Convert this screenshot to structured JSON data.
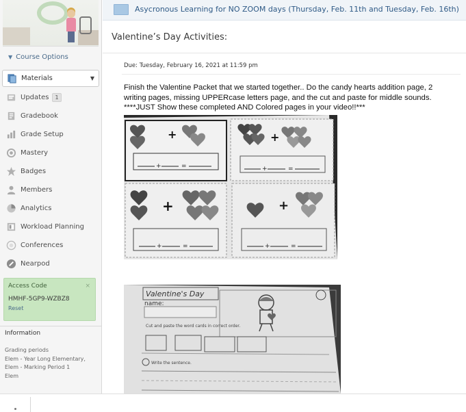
{
  "sidebar": {
    "course_options_label": "Course Options",
    "items": [
      {
        "label": "Materials",
        "icon": "materials-icon",
        "active": true
      },
      {
        "label": "Updates",
        "icon": "updates-icon",
        "count": "1"
      },
      {
        "label": "Gradebook",
        "icon": "gradebook-icon"
      },
      {
        "label": "Grade Setup",
        "icon": "grade-setup-icon"
      },
      {
        "label": "Mastery",
        "icon": "mastery-icon"
      },
      {
        "label": "Badges",
        "icon": "badge-icon"
      },
      {
        "label": "Members",
        "icon": "members-icon"
      },
      {
        "label": "Analytics",
        "icon": "analytics-icon"
      },
      {
        "label": "Workload Planning",
        "icon": "workload-icon"
      },
      {
        "label": "Conferences",
        "icon": "conferences-icon"
      },
      {
        "label": "Nearpod",
        "icon": "nearpod-icon"
      }
    ],
    "access_code": {
      "title": "Access Code",
      "close": "×",
      "code": "HMHF-5GP9-WZBZ8",
      "reset": "Reset"
    },
    "information": {
      "header": "Information",
      "grading_periods_label": "Grading periods",
      "lines": [
        "Elem - Year Long Elementary,",
        "Elem - Marking Period 1",
        "Elem"
      ]
    }
  },
  "main": {
    "folder_title": "Asycronous Learning for NO ZOOM days (Thursday, Feb. 11th and Tuesday, Feb. 16th)",
    "page_title": "Valentine’s Day Activities:",
    "due": "Due: Tuesday, February 16, 2021 at 11:59 pm",
    "description_line1": "Finish the Valentine Packet that we started together.. Do the candy hearts addition page, 2",
    "description_line2": "writing pages, missing UPPERcase letters page, and the cut and paste for middle sounds.",
    "description_line3": "****JUST Show these completed AND Colored pages in your video!!***"
  },
  "worksheet_text": {
    "plus": "+",
    "equals": "=",
    "title": "Valentine's Day",
    "name_label": "name:",
    "cut_paste": "Cut and paste the word cards in correct order.",
    "write_sentence": "Write the sentence."
  },
  "colors": {
    "accent_link": "#2f5a86",
    "access_bg": "#c8e6c0",
    "sidebar_bg": "#f5f5f5"
  }
}
